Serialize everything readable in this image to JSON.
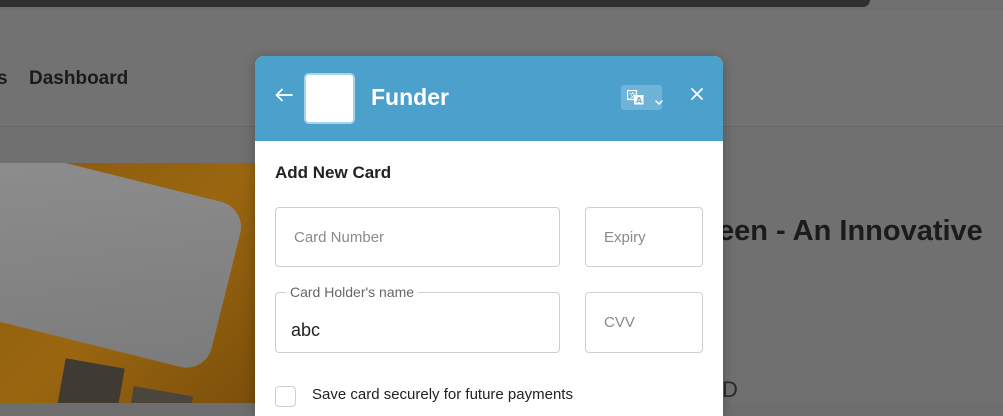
{
  "page": {
    "nav_prev_fragment": "s",
    "nav_dashboard": "Dashboard",
    "product_title_fragment": "een - An Innovative",
    "fragment_s": "s",
    "fragment_d": "D"
  },
  "modal": {
    "brand_name": "Funder",
    "header_color": "#4ba0cc",
    "icons": {
      "back": "arrow-left-icon",
      "language": "translate-icon",
      "close": "close-icon"
    },
    "section_title": "Add New Card",
    "fields": {
      "card_number": {
        "placeholder": "Card Number",
        "value": ""
      },
      "expiry": {
        "placeholder": "Expiry",
        "value": ""
      },
      "holder_name": {
        "label": "Card Holder's name",
        "value": "abc"
      },
      "cvv": {
        "placeholder": "CVV",
        "value": ""
      }
    },
    "save_card_label": "Save card securely for future payments",
    "save_card_checked": false
  }
}
